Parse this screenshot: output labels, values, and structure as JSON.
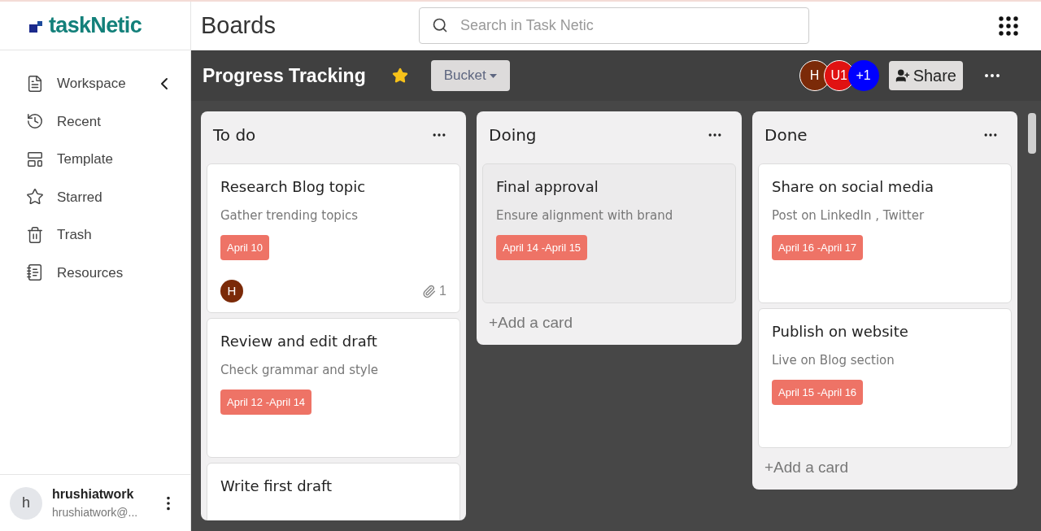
{
  "logo": {
    "text": "taskNetic"
  },
  "page_title": "Boards",
  "search": {
    "placeholder": "Search in Task Netic"
  },
  "sidebar": {
    "items": [
      {
        "label": "Workspace",
        "kind": "workspace",
        "collapse": true
      },
      {
        "label": "Recent",
        "kind": "recent",
        "collapse": false
      },
      {
        "label": "Template",
        "kind": "template",
        "collapse": false
      },
      {
        "label": "Starred",
        "kind": "starred",
        "collapse": false
      },
      {
        "label": "Trash",
        "kind": "trash",
        "collapse": false
      },
      {
        "label": "Resources",
        "kind": "resources",
        "collapse": false
      }
    ],
    "user": {
      "initial": "h",
      "name": "hrushiatwork",
      "email": "hrushiatwork@..."
    }
  },
  "board": {
    "title": "Progress Tracking",
    "starred": true,
    "view_button": "Bucket",
    "members": [
      {
        "label": "H",
        "color": "#7b2a08"
      },
      {
        "label": "U1",
        "color": "#e01212"
      },
      {
        "label": "+1",
        "color": "#0000ff"
      }
    ],
    "share_button": "Share",
    "lists": [
      {
        "title": "To do",
        "cards": [
          {
            "title": "Research Blog topic",
            "description": "Gather trending topics",
            "date": "April 10",
            "highlighted": false,
            "assignee": "H",
            "attachments": "1"
          },
          {
            "title": "Review and edit draft",
            "description": "Check grammar and style",
            "date": "April 12 -April 14",
            "highlighted": false
          },
          {
            "title": "Write first draft",
            "highlighted": false
          }
        ]
      },
      {
        "title": "Doing",
        "add_card": "+Add a card",
        "cards": [
          {
            "title": "Final approval",
            "description": "Ensure alignment with brand",
            "date": "April 14 -April 15",
            "highlighted": true
          }
        ]
      },
      {
        "title": "Done",
        "add_card": "+Add a card",
        "cards": [
          {
            "title": "Share on social media",
            "description": "Post on LinkedIn , Twitter",
            "date": "April 16 -April 17",
            "highlighted": false
          },
          {
            "title": "Publish on website",
            "description": "Live on Blog section",
            "date": "April 15 -April 16",
            "highlighted": false
          }
        ]
      }
    ]
  }
}
